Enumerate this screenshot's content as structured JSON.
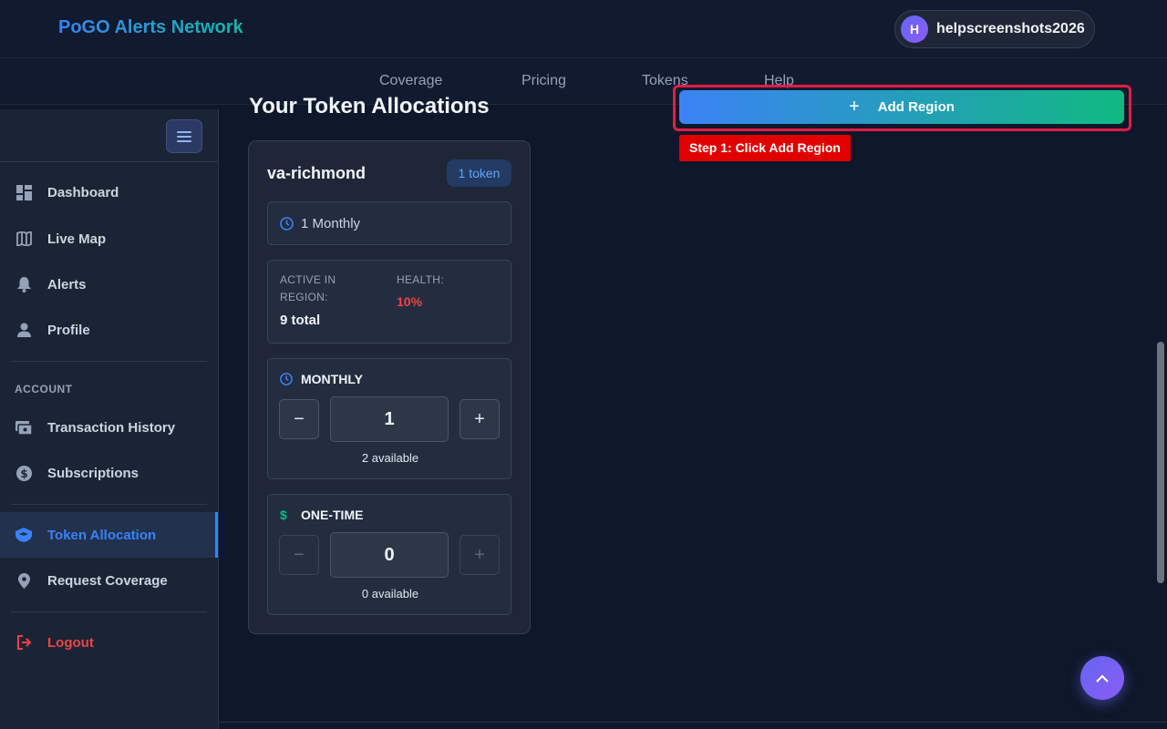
{
  "header": {
    "brand": "PoGO Alerts Network",
    "user": {
      "initial": "H",
      "name": "helpscreenshots2026"
    }
  },
  "nav": {
    "items": [
      "Coverage",
      "Pricing",
      "Tokens",
      "Help"
    ]
  },
  "sidebar": {
    "main_items": [
      {
        "label": "Dashboard",
        "icon": "dashboard-icon"
      },
      {
        "label": "Live Map",
        "icon": "map-icon"
      },
      {
        "label": "Alerts",
        "icon": "bell-icon"
      },
      {
        "label": "Profile",
        "icon": "user-icon"
      }
    ],
    "account_section": "ACCOUNT",
    "account_items": [
      {
        "label": "Transaction History",
        "icon": "receipt-icon"
      },
      {
        "label": "Subscriptions",
        "icon": "dollar-circle-icon"
      }
    ],
    "active_item": {
      "label": "Token Allocation",
      "icon": "token-icon"
    },
    "coverage_item": {
      "label": "Request Coverage",
      "icon": "location-pin-icon"
    },
    "logout": {
      "label": "Logout",
      "icon": "logout-icon"
    }
  },
  "main": {
    "title": "Your Token Allocations",
    "add_region_label": "Add Region",
    "annotation": "Step 1: Click Add Region",
    "region_card": {
      "name": "va-richmond",
      "badge": "1 token",
      "summary": "1 Monthly",
      "active_label": "ACTIVE IN REGION:",
      "active_value": "9 total",
      "health_label": "HEALTH:",
      "health_value": "10%",
      "monthly": {
        "label": "MONTHLY",
        "value": "1",
        "available": "2 available"
      },
      "one_time": {
        "label": "ONE-TIME",
        "value": "0",
        "available": "0 available"
      }
    }
  },
  "colors": {
    "accent": "#3b82f6",
    "teal": "#14b8a6",
    "danger": "#ef4444",
    "annotation": "#e00000"
  }
}
